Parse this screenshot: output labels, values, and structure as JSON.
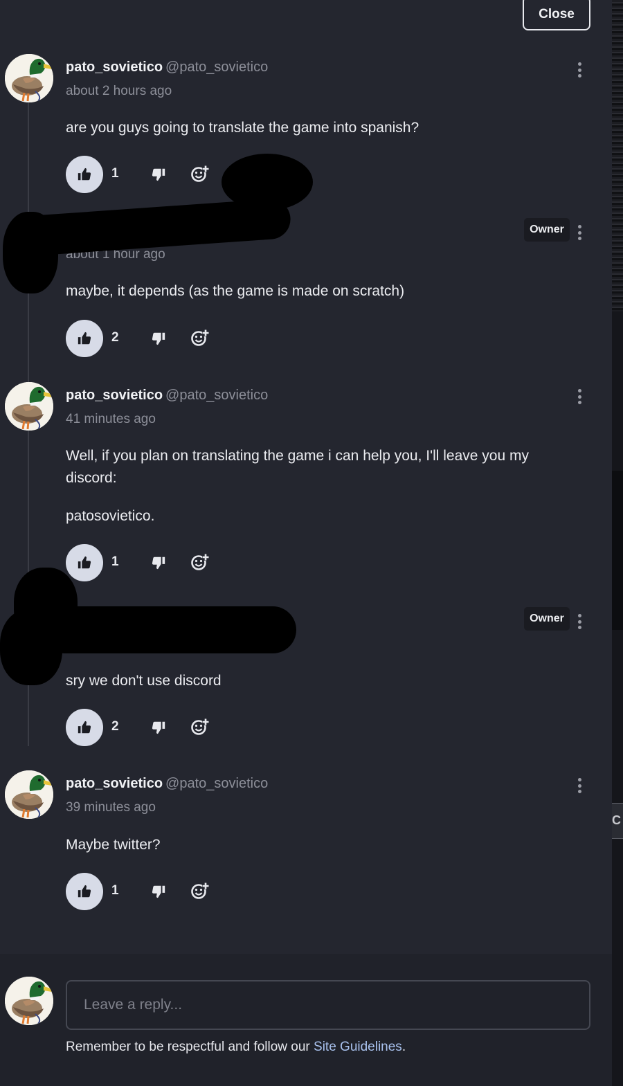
{
  "dialog": {
    "close_label": "Close"
  },
  "comments": [
    {
      "username": "pato_sovietico",
      "handle": "@pato_sovietico",
      "time": "about 2 hours ago",
      "paragraphs": [
        "are you guys going to translate the game into spanish?"
      ],
      "likes": "1",
      "owner": false
    },
    {
      "username": "",
      "handle": "",
      "time": "about 1 hour ago",
      "paragraphs": [
        "maybe, it depends (as the game is made on scratch)"
      ],
      "likes": "2",
      "owner": true,
      "owner_label": "Owner"
    },
    {
      "username": "pato_sovietico",
      "handle": "@pato_sovietico",
      "time": "41 minutes ago",
      "paragraphs": [
        "Well, if you plan on translating the game i can help you, I'll leave you my discord:",
        "patosovietico."
      ],
      "likes": "1",
      "owner": false
    },
    {
      "username": "",
      "handle": "",
      "time": "",
      "paragraphs": [
        "sry we don't use discord"
      ],
      "likes": "2",
      "owner": true,
      "owner_label": "Owner"
    },
    {
      "username": "pato_sovietico",
      "handle": "@pato_sovietico",
      "time": "39 minutes ago",
      "paragraphs": [
        "Maybe twitter?"
      ],
      "likes": "1",
      "owner": false
    }
  ],
  "reply": {
    "placeholder": "Leave a reply...",
    "guidelines_prefix": "Remember to be respectful and follow our ",
    "guidelines_link": "Site Guidelines",
    "guidelines_suffix": "."
  },
  "icons": {
    "like": "thumbs-up-icon",
    "dislike": "thumbs-down-icon",
    "react": "add-reaction-icon",
    "menu": "more-vertical-icon",
    "avatar": "mallard-duck-avatar"
  },
  "colors": {
    "background": "#24262f",
    "like_button": "#d7dbe7",
    "link": "#a9c2ee",
    "muted_text": "#8d8f99"
  },
  "edge_fragment": "C"
}
